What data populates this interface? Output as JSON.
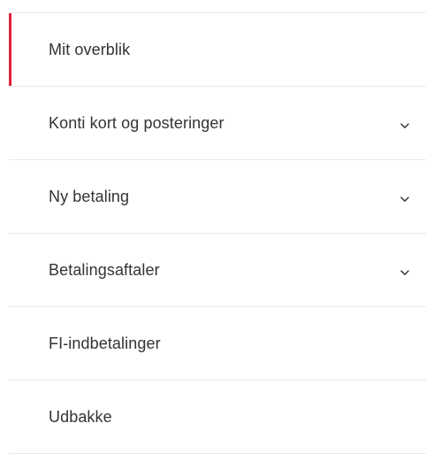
{
  "menu": {
    "accent_color": "#e3223b",
    "items": [
      {
        "label": "Mit overblik",
        "active": true,
        "expandable": false
      },
      {
        "label": "Konti kort og posteringer",
        "active": false,
        "expandable": true,
        "icon": "chevron-down-icon"
      },
      {
        "label": "Ny betaling",
        "active": false,
        "expandable": true,
        "icon": "chevron-down-icon"
      },
      {
        "label": "Betalingsaftaler",
        "active": false,
        "expandable": true,
        "icon": "chevron-down-icon"
      },
      {
        "label": "FI-indbetalinger",
        "active": false,
        "expandable": false
      },
      {
        "label": "Udbakke",
        "active": false,
        "expandable": false
      }
    ]
  }
}
